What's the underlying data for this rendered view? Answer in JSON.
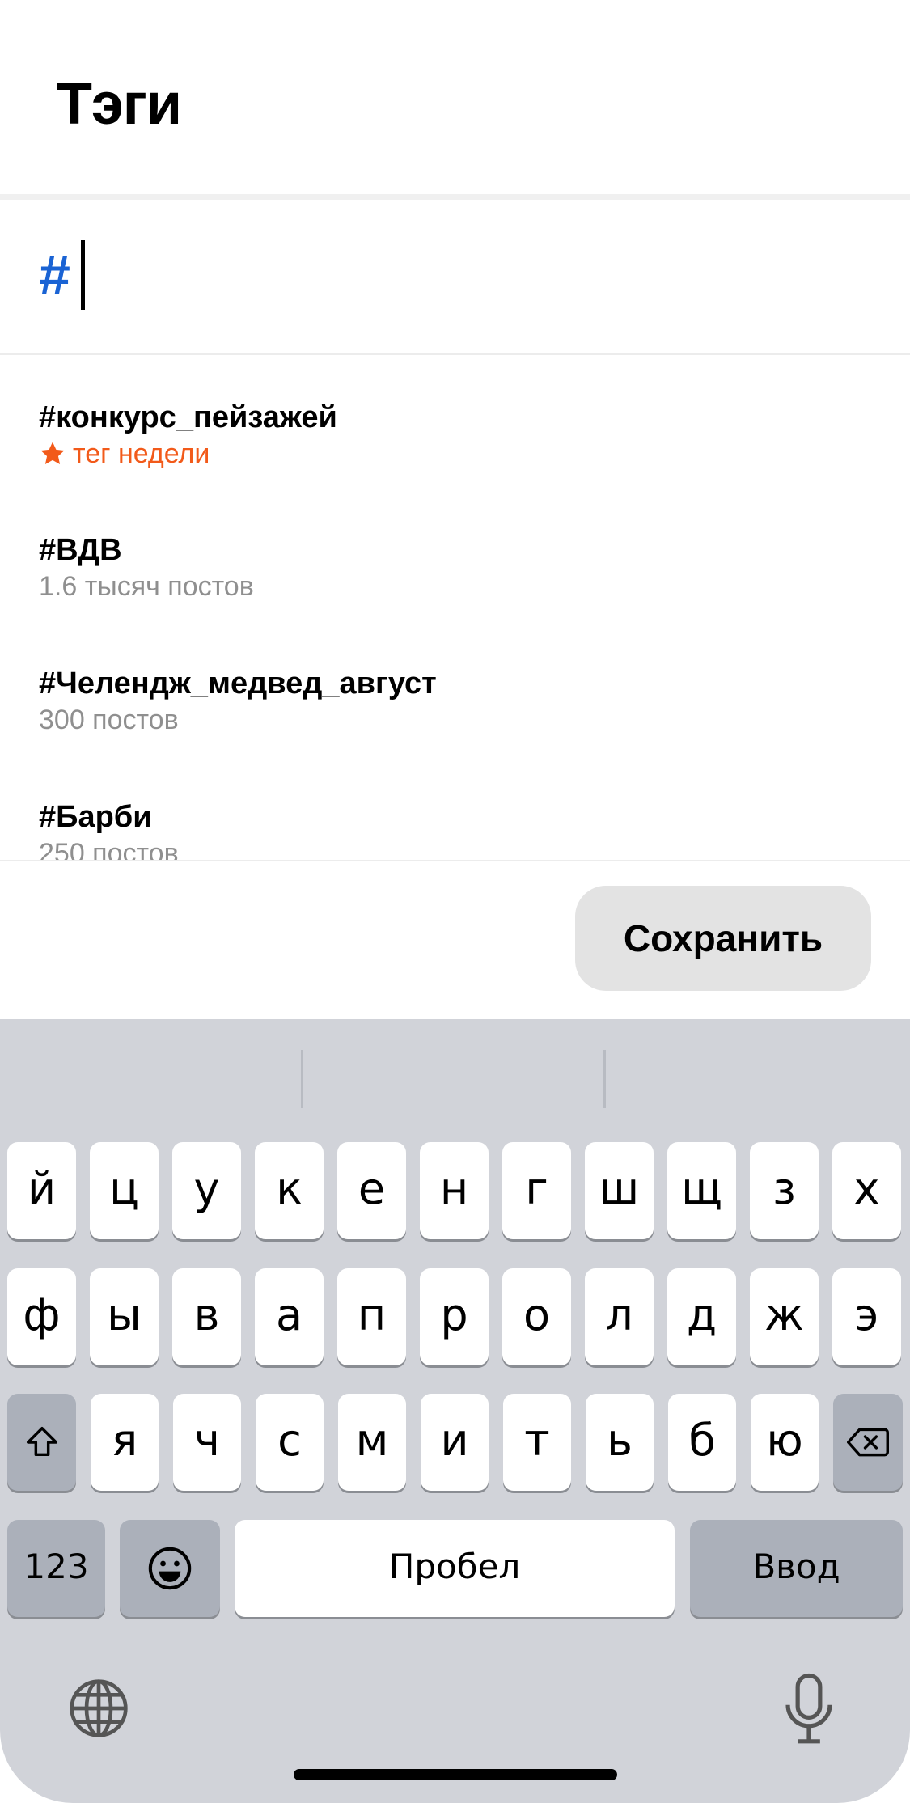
{
  "header": {
    "title": "Тэги"
  },
  "input": {
    "prefix": "#",
    "value": ""
  },
  "tags": [
    {
      "name": "#конкурс_пейзажей",
      "subtitle": "тег недели",
      "highlight": true,
      "icon": "star-icon"
    },
    {
      "name": "#ВДВ",
      "subtitle": "1.6 тысяч постов",
      "highlight": false
    },
    {
      "name": "#Челендж_медвед_август",
      "subtitle": "300 постов",
      "highlight": false
    },
    {
      "name": "#Барби",
      "subtitle": "250 постов",
      "highlight": false
    }
  ],
  "actions": {
    "save_label": "Сохранить"
  },
  "keyboard": {
    "row1": [
      "й",
      "ц",
      "у",
      "к",
      "е",
      "н",
      "г",
      "ш",
      "щ",
      "з",
      "х"
    ],
    "row2": [
      "ф",
      "ы",
      "в",
      "а",
      "п",
      "р",
      "о",
      "л",
      "д",
      "ж",
      "э"
    ],
    "row3": [
      "я",
      "ч",
      "с",
      "м",
      "и",
      "т",
      "ь",
      "б",
      "ю"
    ],
    "numbers_label": "123",
    "space_label": "Пробел",
    "return_label": "Ввод",
    "icons": [
      "shift-icon",
      "backspace-icon",
      "emoji-icon",
      "globe-icon",
      "microphone-icon"
    ]
  },
  "colors": {
    "accent": "#1a63d4",
    "highlight": "#f25a1a",
    "muted": "#8f8f8f",
    "keyboard_bg": "#d1d3d9"
  }
}
